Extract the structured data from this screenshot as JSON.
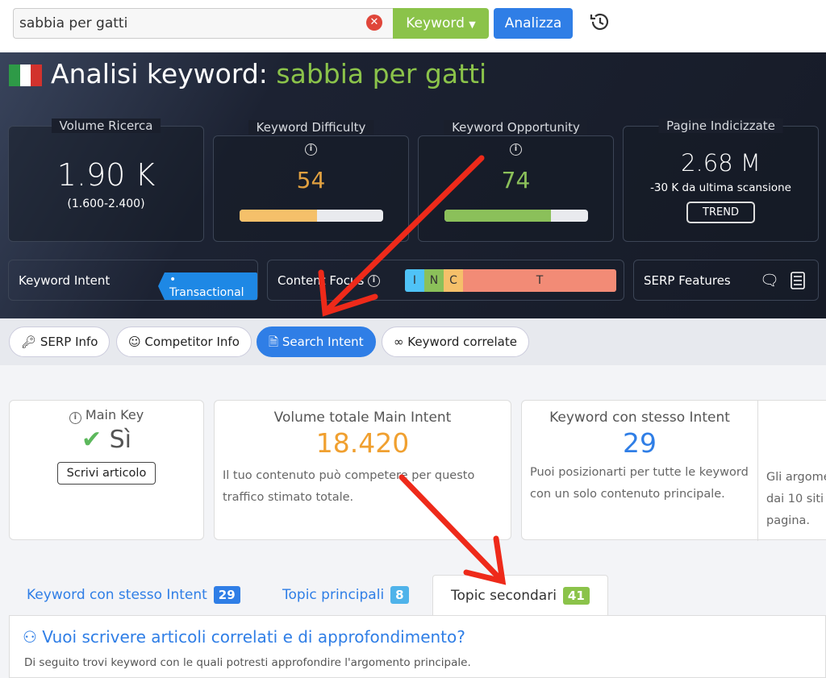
{
  "search": {
    "value": "sabbia per gatti",
    "type_label": "Keyword",
    "analyze_label": "Analizza"
  },
  "header": {
    "title_prefix": "Analisi keyword:",
    "keyword": "sabbia per gatti"
  },
  "metrics": {
    "volume": {
      "label": "Volume Ricerca",
      "value": "1.90 K",
      "range": "(1.600-2.400)"
    },
    "difficulty": {
      "label": "Keyword Difficulty",
      "value": "54",
      "percent": 54,
      "color": "#f5c06a"
    },
    "opportunity": {
      "label": "Keyword Opportunity",
      "value": "74",
      "percent": 74,
      "color": "#8bc05a"
    },
    "indexed": {
      "label": "Pagine Indicizzate",
      "value": "2.68 M",
      "change": "-30 K da ultima scansione",
      "trend_label": "TREND"
    }
  },
  "intent": {
    "label": "Keyword Intent",
    "value": "Transactional"
  },
  "content_focus": {
    "label": "Content Focus",
    "segments": [
      {
        "letter": "I",
        "color": "#4fc3f7",
        "share": 5
      },
      {
        "letter": "N",
        "color": "#8bc05a",
        "share": 5
      },
      {
        "letter": "C",
        "color": "#f5c06a",
        "share": 6
      },
      {
        "letter": "T",
        "color": "#f28b76",
        "share": 84
      }
    ]
  },
  "serp_features": {
    "label": "SERP Features"
  },
  "nav_tabs": [
    {
      "label": "SERP Info",
      "icon": "key-icon"
    },
    {
      "label": "Competitor Info",
      "icon": "competitor-icon"
    },
    {
      "label": "Search Intent",
      "icon": "document-icon",
      "active": true
    },
    {
      "label": "Keyword correlate",
      "icon": "infinity-icon"
    }
  ],
  "summary": {
    "main_key": {
      "label": "Main Key",
      "value": "Sì",
      "button": "Scrivi articolo"
    },
    "volume_total": {
      "label": "Volume totale Main Intent",
      "value": "18.420",
      "desc": "Il tuo contenuto può competere per questo traffico stimato totale."
    },
    "same_intent": {
      "label": "Keyword con stesso Intent",
      "value": "29",
      "desc": "Puoi posizionarti per tutte le keyword con un solo contenuto principale."
    },
    "partial": {
      "desc_lines": [
        "Gli argome",
        "dai 10 siti",
        "pagina."
      ]
    }
  },
  "content_tabs": [
    {
      "label": "Keyword con stesso Intent",
      "count": "29",
      "color": "#2f7ee6"
    },
    {
      "label": "Topic principali",
      "count": "8",
      "color": "#4fb3ea"
    },
    {
      "label": "Topic secondari",
      "count": "41",
      "color": "#8bc34a",
      "active": true
    }
  ],
  "panel": {
    "heading": "Vuoi scrivere articoli correlati e di approfondimento?",
    "subtext": "Di seguito trovi keyword con le quali potresti approfondire l'argomento principale."
  }
}
